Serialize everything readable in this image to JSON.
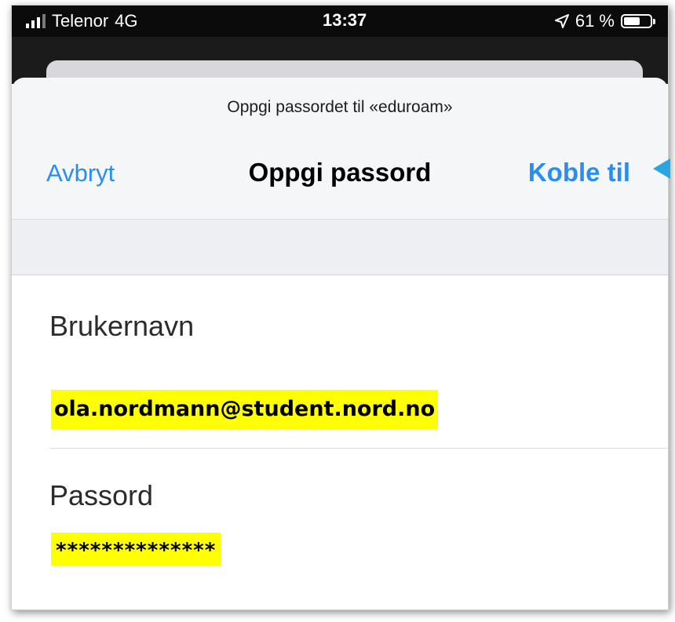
{
  "status_bar": {
    "carrier": "Telenor",
    "network": "4G",
    "time": "13:37",
    "location_icon": "location-arrow-icon",
    "battery": "61 %",
    "battery_level": 0.61
  },
  "dialog": {
    "subtitle": "Oppgi passordet til «eduroam»",
    "cancel_label": "Avbryt",
    "title": "Oppgi passord",
    "connect_label": "Koble til"
  },
  "form": {
    "username_label": "Brukernavn",
    "username_value": "ola.nordmann@student.nord.no",
    "password_label": "Passord",
    "password_value": "**************"
  },
  "colors": {
    "accent": "#2a8ef0",
    "highlight": "#ffff00",
    "annotation_arrow": "#2aa5e0"
  }
}
